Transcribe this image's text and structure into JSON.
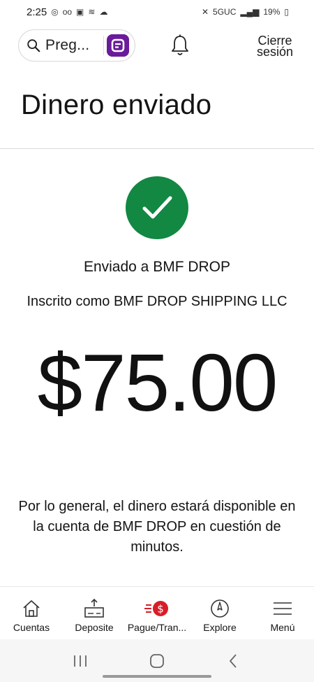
{
  "status_bar": {
    "time": "2:25",
    "network": "5GUC",
    "battery": "19%"
  },
  "header": {
    "search_placeholder": "Preg...",
    "logout_label": "Cierre sesión"
  },
  "page": {
    "title": "Dinero enviado"
  },
  "confirmation": {
    "sent_to": "Enviado a BMF DROP",
    "registered_as": "Inscrito como BMF DROP SHIPPING LLC",
    "amount": "$75.00",
    "note": "Por lo general, el dinero estará disponible en la cuenta de BMF DROP en cuestión de minutos."
  },
  "bottom_nav": [
    {
      "label": "Cuentas",
      "icon": "house-icon"
    },
    {
      "label": "Deposite",
      "icon": "deposit-check-icon"
    },
    {
      "label": "Pague/Tran...",
      "icon": "pay-transfer-icon"
    },
    {
      "label": "Explore",
      "icon": "compass-icon"
    },
    {
      "label": "Menú",
      "icon": "hamburger-menu-icon"
    }
  ],
  "colors": {
    "success_green": "#128842",
    "assistant_purple": "#6a1b9a",
    "pay_red": "#d71e28"
  }
}
